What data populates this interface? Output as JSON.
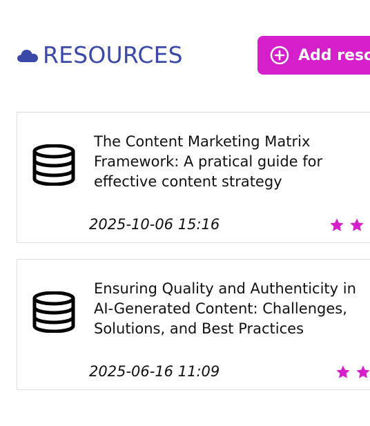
{
  "header": {
    "title": "RESOURCES",
    "cloud_icon": "cloud-icon",
    "add_button_label": "Add resou",
    "add_button_icon": "plus-circle-icon"
  },
  "colors": {
    "title": "#3a49a8",
    "accent": "#d41fca",
    "card_border": "#dedede",
    "text": "#111111"
  },
  "resources": [
    {
      "icon": "database-icon",
      "title": "The Content Marketing Matrix Framework: A pratical guide for effective content strategy",
      "date": "2025-10-06 15:16",
      "stars_visible": 2
    },
    {
      "icon": "database-icon",
      "title": "Ensuring Quality and Authenticity in AI-Generated Content: Challenges, Solutions, and Best Practices",
      "date": "2025-06-16 11:09",
      "stars_visible": 2
    }
  ]
}
